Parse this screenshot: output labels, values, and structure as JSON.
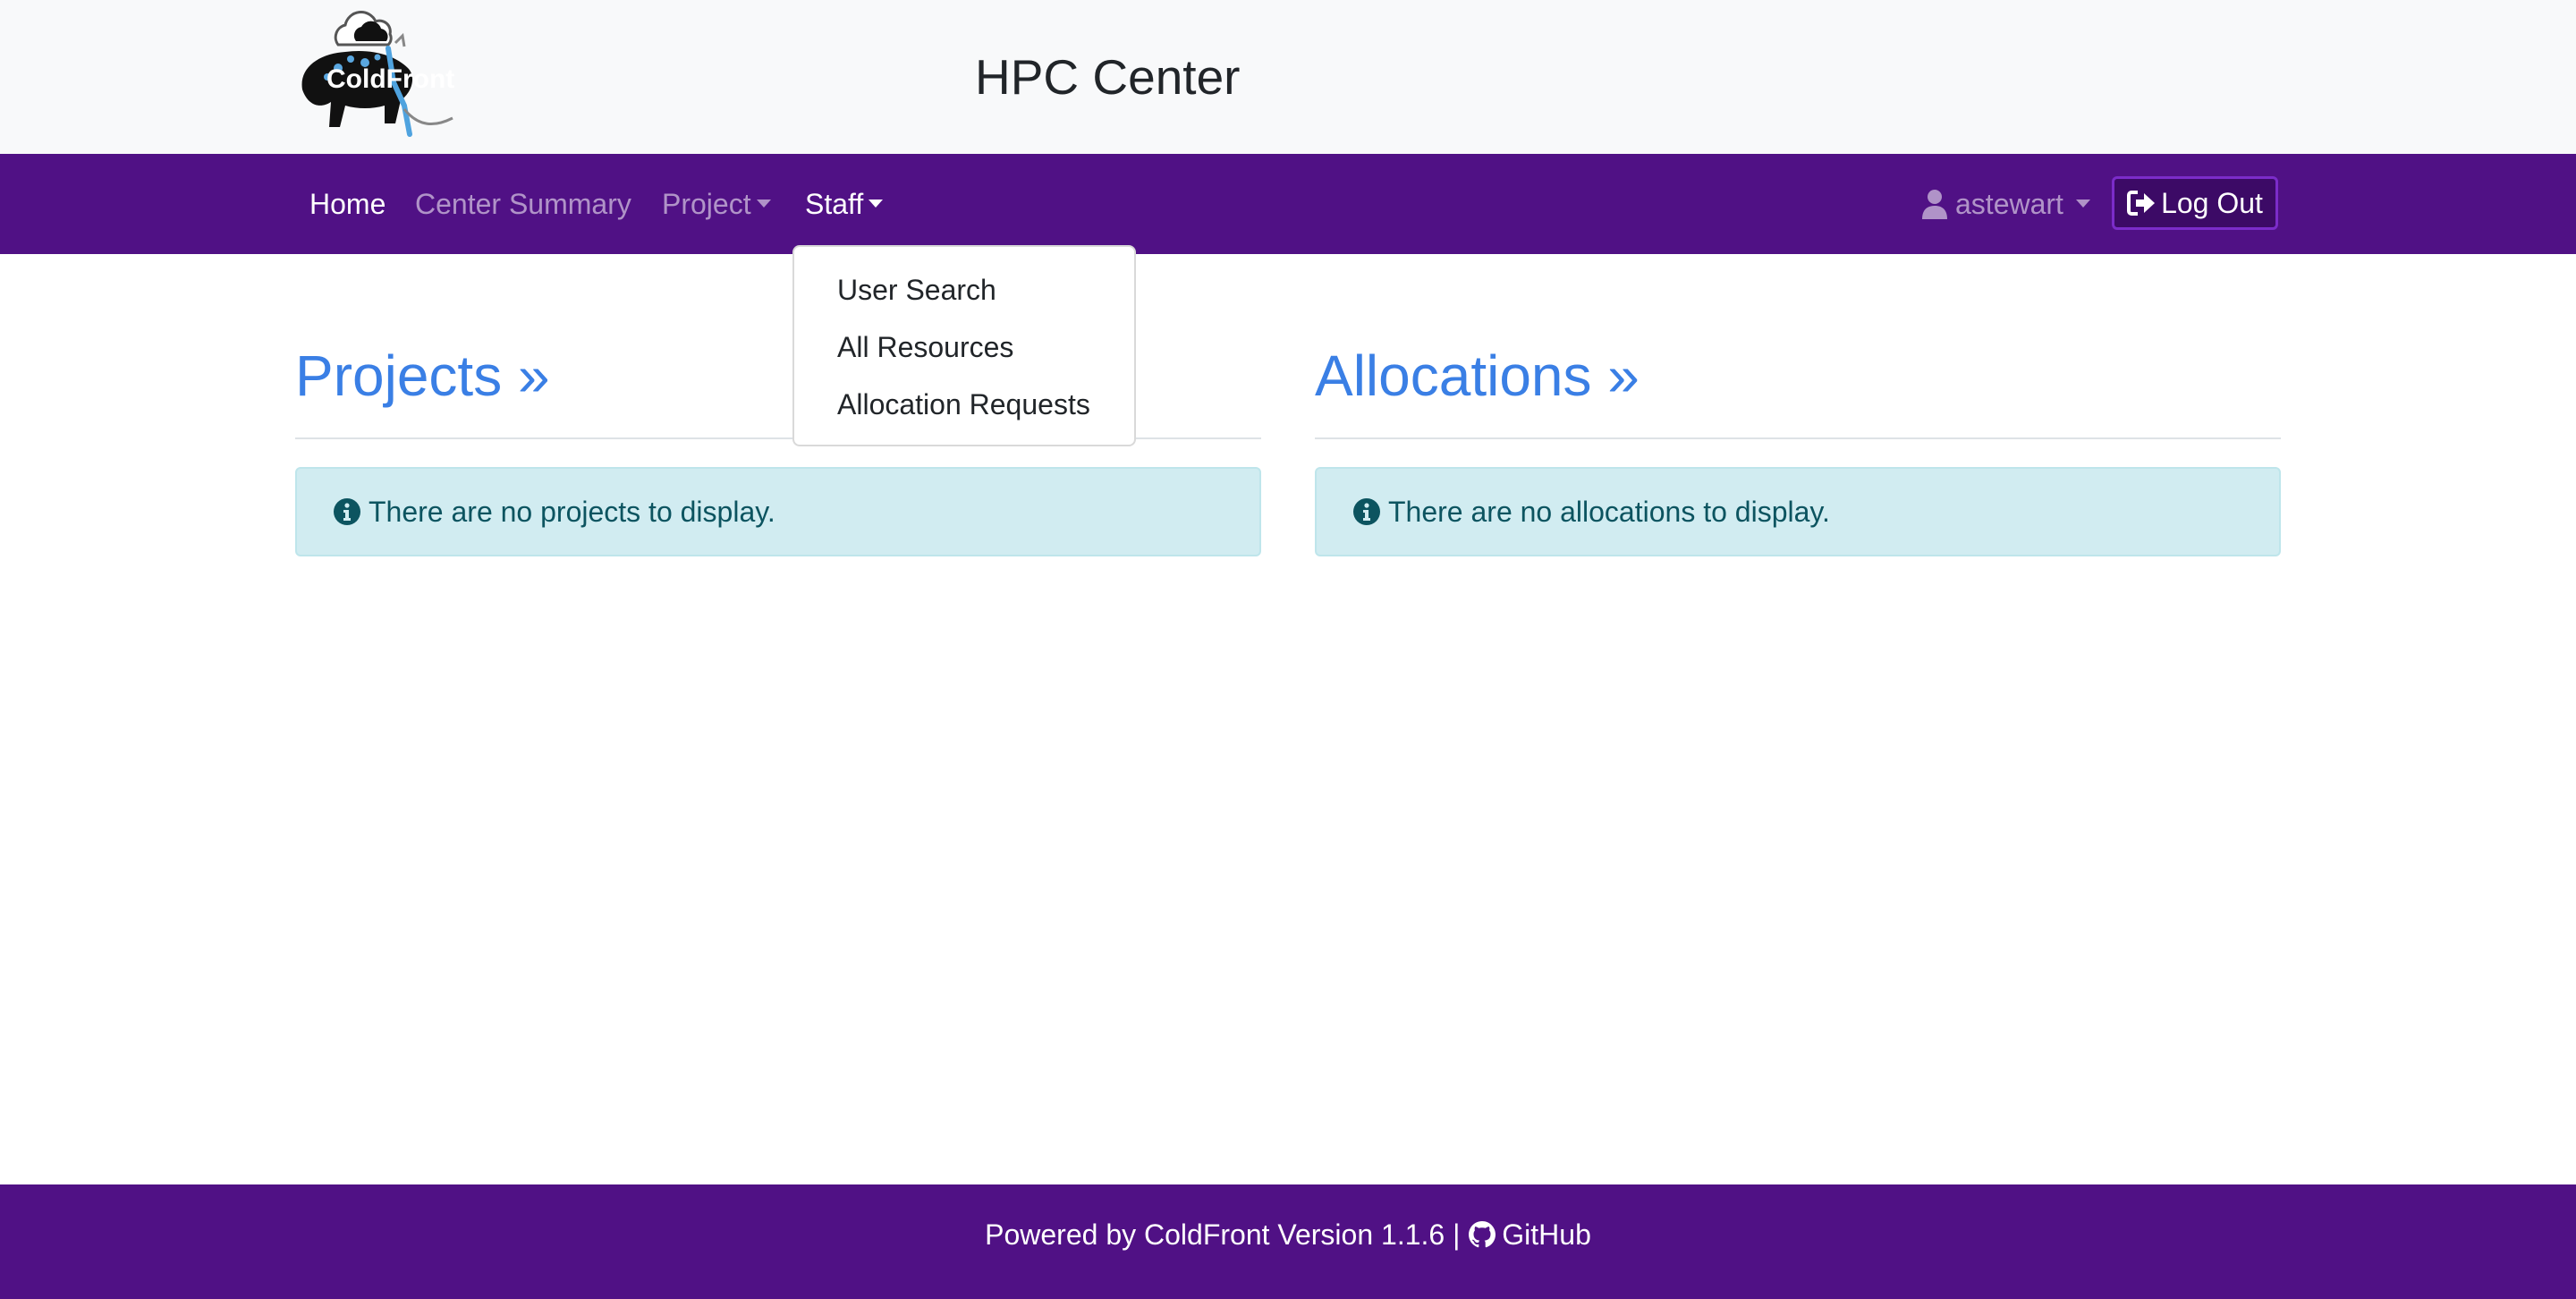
{
  "header": {
    "logo_text": "ColdFront",
    "title": "HPC Center"
  },
  "nav": {
    "home": "Home",
    "center_summary": "Center Summary",
    "project": "Project",
    "staff": "Staff",
    "user": "astewart",
    "logout": "Log Out"
  },
  "staff_dropdown": {
    "items": [
      "User Search",
      "All Resources",
      "Allocation Requests"
    ]
  },
  "projects": {
    "heading": "Projects »",
    "empty_message": "There are no projects to display."
  },
  "allocations": {
    "heading": "Allocations »",
    "empty_message": "There are no allocations to display."
  },
  "footer": {
    "text": "Powered by ColdFront Version 1.1.6 |",
    "github": "GitHub"
  },
  "colors": {
    "navbar": "#501185",
    "link": "#3a7fe5",
    "alert_bg": "#d1ecf1",
    "alert_text": "#0c5460"
  },
  "icons": [
    "user-icon",
    "logout-icon",
    "info-icon",
    "github-icon",
    "caret-down-icon"
  ]
}
